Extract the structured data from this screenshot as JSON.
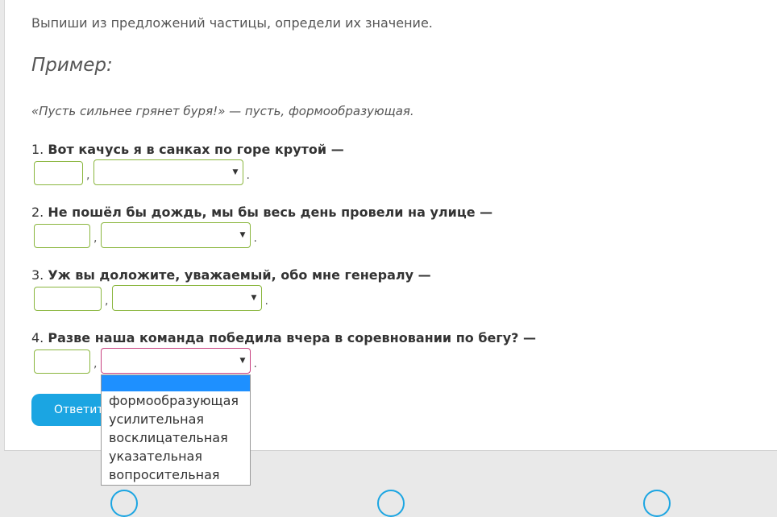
{
  "instruction": "Выпиши из предложений частицы, определи их значение.",
  "example": {
    "title": "Пример:",
    "text": "«Пусть сильнее грянет буря!» — пусть, формообразующая."
  },
  "questions": [
    {
      "num": "1.",
      "text": "Вот качусь я в санках по горе крутой —",
      "comma": ",",
      "period": ".",
      "particle_value": "",
      "meaning_value": ""
    },
    {
      "num": "2.",
      "text": "Не пошёл бы дождь, мы бы весь день провели на улице —",
      "comma": ",",
      "period": ".",
      "particle_value": "",
      "meaning_value": ""
    },
    {
      "num": "3.",
      "text": "Уж вы доложите, уважаемый, обо мне генералу —",
      "comma": ",",
      "period": ".",
      "particle_value": "",
      "meaning_value": ""
    },
    {
      "num": "4.",
      "text": "Разве наша команда победила вчера в соревновании по бегу? —",
      "comma": ",",
      "period": ".",
      "particle_value": "",
      "meaning_value": ""
    }
  ],
  "dropdown_options": [
    "",
    "формообразующая",
    "усилительная",
    "восклицательная",
    "указательная",
    "вопросительная"
  ],
  "submit_label": "Ответить",
  "icons": {
    "select_arrow": "▼"
  },
  "colors": {
    "input_border": "#8ab63e",
    "active_border": "#c7407f",
    "button": "#1ba5e2",
    "highlight": "#1e90ff"
  }
}
